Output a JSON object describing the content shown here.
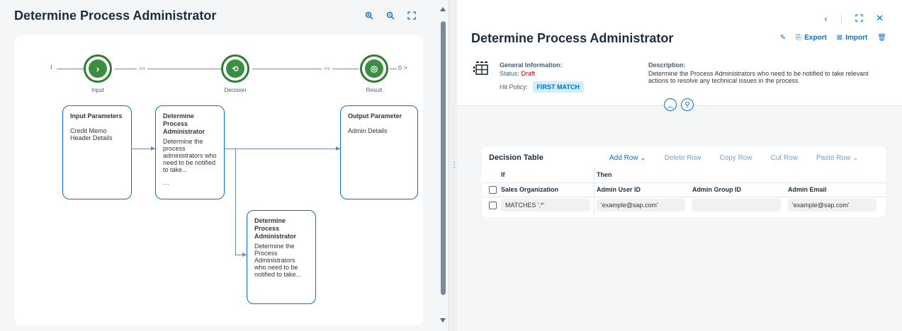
{
  "left": {
    "title": "Determine Process Administrator",
    "flow": {
      "nodes": [
        {
          "label": "Input"
        },
        {
          "label": "Decision"
        },
        {
          "label": "Result"
        }
      ],
      "marker_start": "I",
      "marker_end": "0 >",
      "chevrons": "»»",
      "cards": {
        "input": {
          "title": "Input Parameters",
          "body": "Credit Memo Header Details"
        },
        "decision1": {
          "title": "Determine Process Administrator",
          "body": "Determine the process administrators who need to be notified to take...",
          "extra": "…"
        },
        "output": {
          "title": "Output Parameter",
          "body": "Admin Details"
        },
        "decision2": {
          "title": "Determine Process Administrator",
          "body": "Determine the Process Administrators who need to be notified to take..."
        }
      }
    },
    "tools": [
      "zoom-in-icon",
      "zoom-out-icon",
      "fit-icon"
    ]
  },
  "right": {
    "title": "Determine Process Administrator",
    "actions": {
      "export": "Export",
      "import": "Import"
    },
    "general_info": {
      "heading": "General Information:",
      "status_label": "Status:",
      "status_value": "Draft",
      "hit_policy_label": "Hit Policy:",
      "hit_policy_value": "FIRST MATCH"
    },
    "description": {
      "heading": "Description:",
      "text": "Determine the Process Administrators who need to be notified to take relevant actions to resolve any technical issues in the process"
    },
    "decision_table": {
      "title": "Decision Table",
      "actions": {
        "add_row": "Add Row",
        "delete_row": "Delete Row",
        "copy_row": "Copy Row",
        "cut_row": "Cut Row",
        "paste_row": "Paste Row"
      },
      "group_headers": {
        "if": "If",
        "then": "Then"
      },
      "columns": [
        "Sales Organization",
        "Admin User ID",
        "Admin Group ID",
        "Admin Email"
      ],
      "rows": [
        [
          "MATCHES '.*'",
          "'example@sap.com'",
          "",
          "'example@sap.com'"
        ]
      ]
    }
  },
  "colors": {
    "accent": "#0a6ed1",
    "node_green": "#2e7d32",
    "draft": "#aa0808"
  }
}
